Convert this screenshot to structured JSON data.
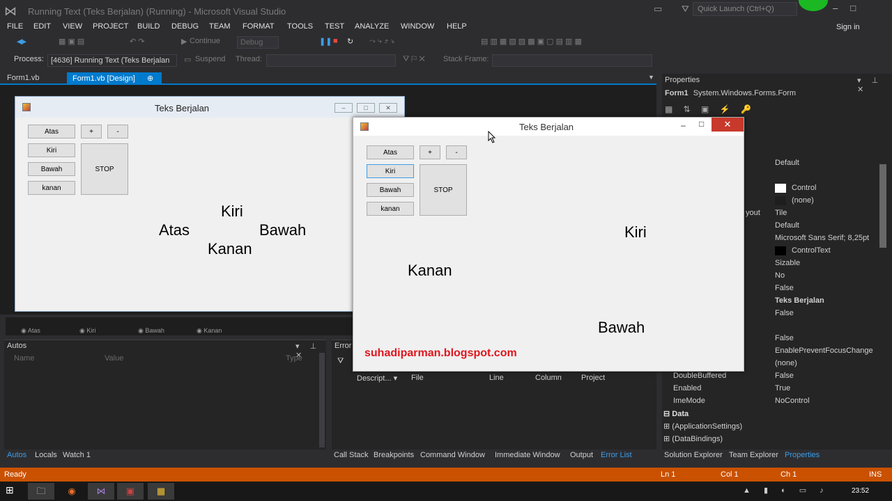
{
  "window_title": "Running Text (Teks Berjalan) (Running) - Microsoft Visual Studio",
  "quick_launch_placeholder": "Quick Launch (Ctrl+Q)",
  "sign_in": "Sign in",
  "menu": [
    "FILE",
    "EDIT",
    "VIEW",
    "PROJECT",
    "BUILD",
    "DEBUG",
    "TEAM",
    "FORMAT",
    "TOOLS",
    "TEST",
    "ANALYZE",
    "WINDOW",
    "HELP"
  ],
  "toolbar": {
    "continue_label": "Continue",
    "config": "Debug",
    "process_label": "Process:",
    "process_value": "[4636] Running Text (Teks Berjalan",
    "suspend_label": "Suspend",
    "thread_label": "Thread:",
    "stack_frame_label": "Stack Frame:"
  },
  "doc_tabs": {
    "tab1": "Form1.vb",
    "tab2": "Form1.vb [Design]"
  },
  "design_form": {
    "title": "Teks Berjalan",
    "buttons": {
      "atas": "Atas",
      "kiri": "Kiri",
      "bawah": "Bawah",
      "kanan": "kanan",
      "plus": "+",
      "minus": "-",
      "stop": "STOP"
    },
    "labels": {
      "kiri": "Kiri",
      "atas": "Atas",
      "bawah": "Bawah",
      "kanan": "Kanan"
    }
  },
  "running_form": {
    "title": "Teks Berjalan",
    "buttons": {
      "atas": "Atas",
      "kiri": "Kiri",
      "bawah": "Bawah",
      "kanan": "kanan",
      "plus": "+",
      "minus": "-",
      "stop": "STOP"
    },
    "labels": {
      "kiri": "Kiri",
      "kanan": "Kanan",
      "bawah": "Bawah"
    },
    "link": "suhadiparman.blogspot.com"
  },
  "component_tray": [
    "Atas",
    "Kiri",
    "Bawah",
    "Kanan"
  ],
  "autos": {
    "title": "Autos",
    "columns": [
      "Name",
      "Value",
      "Type"
    ]
  },
  "error_list": {
    "title": "Error",
    "columns": [
      "Descript...",
      "File",
      "Line",
      "Column",
      "Project"
    ]
  },
  "bottom_tabs_left": [
    "Autos",
    "Locals",
    "Watch 1"
  ],
  "bottom_tabs_right": [
    "Call Stack",
    "Breakpoints",
    "Command Window",
    "Immediate Window",
    "Output",
    "Error List"
  ],
  "properties": {
    "title": "Properties",
    "object_name": "Form1",
    "object_type": "System.Windows.Forms.Form",
    "rows": [
      {
        "name": "",
        "value": "Default"
      },
      {
        "name": "",
        "value": "Control",
        "swatch": "#ffffff"
      },
      {
        "name": "",
        "value": "(none)",
        "swatch": "#1e1e1e"
      },
      {
        "name": "yout",
        "value": "Tile"
      },
      {
        "name": "",
        "value": "Default"
      },
      {
        "name": "",
        "value": "Microsoft Sans Serif; 8,25pt"
      },
      {
        "name": "",
        "value": "ControlText",
        "swatch": "#000000"
      },
      {
        "name": "",
        "value": "Sizable"
      },
      {
        "name": "",
        "value": "No"
      },
      {
        "name": "",
        "value": "False"
      },
      {
        "name": "",
        "value": "Teks Berjalan",
        "bold": true
      },
      {
        "name": "",
        "value": "False"
      },
      {
        "name": "",
        "value": "False"
      },
      {
        "name": "",
        "value": "EnablePreventFocusChange"
      },
      {
        "name": "",
        "value": "(none)"
      },
      {
        "name": "DoubleBuffered",
        "value": "False"
      },
      {
        "name": "Enabled",
        "value": "True"
      },
      {
        "name": "ImeMode",
        "value": "NoControl"
      }
    ],
    "category_data": "Data",
    "sub_rows": [
      "(ApplicationSettings)",
      "(DataBindings)"
    ]
  },
  "properties_tabs": [
    "Solution Explorer",
    "Team Explorer",
    "Properties"
  ],
  "status": {
    "ready": "Ready",
    "ln": "Ln 1",
    "col": "Col 1",
    "ch": "Ch 1",
    "ins": "INS"
  },
  "clock": "23:52",
  "colors": {
    "accent": "#007acc",
    "status_bar": "#ca5100",
    "link_red": "#e0161e",
    "close_red": "#c7392b"
  }
}
